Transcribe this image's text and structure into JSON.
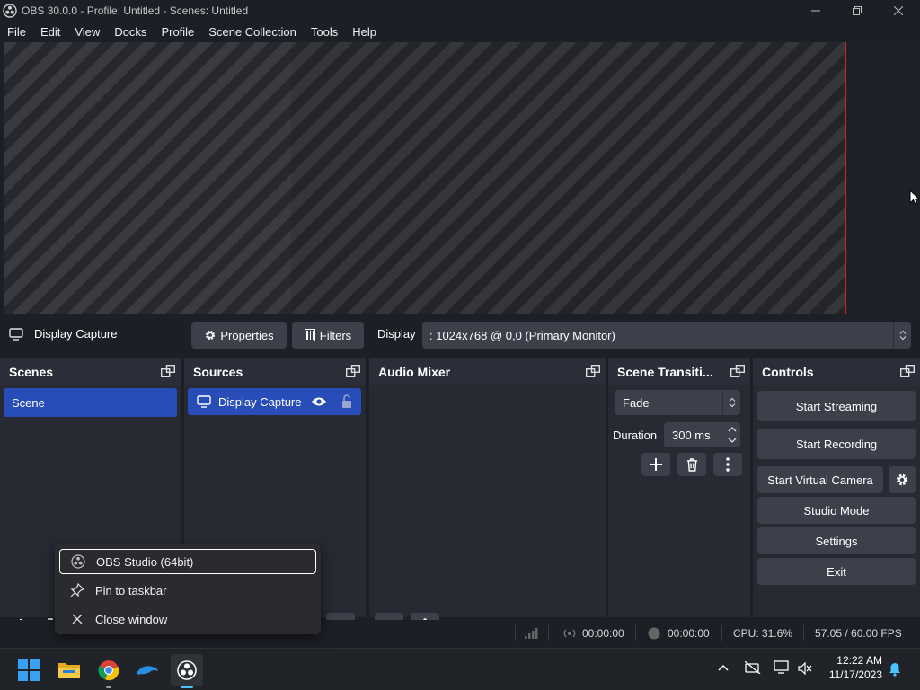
{
  "window": {
    "title": "OBS 30.0.0 - Profile: Untitled - Scenes: Untitled",
    "minimize_icon": "minimize-icon",
    "maximize_icon": "restore-icon",
    "close_icon": "close-icon"
  },
  "menu": [
    "File",
    "Edit",
    "View",
    "Docks",
    "Profile",
    "Scene Collection",
    "Tools",
    "Help"
  ],
  "source_toolbar": {
    "selected_source": "Display Capture",
    "properties_label": "Properties",
    "filters_label": "Filters",
    "display_label": "Display",
    "display_value": ": 1024x768 @ 0,0 (Primary Monitor)"
  },
  "docks": {
    "scenes": {
      "title": "Scenes",
      "items": [
        "Scene"
      ]
    },
    "sources": {
      "title": "Sources",
      "items": [
        "Display Capture"
      ]
    },
    "audio_mixer": {
      "title": "Audio Mixer"
    },
    "transitions": {
      "title": "Scene Transiti...",
      "selected": "Fade",
      "duration_label": "Duration",
      "duration_value": "300 ms"
    },
    "controls": {
      "title": "Controls",
      "start_streaming": "Start Streaming",
      "start_recording": "Start Recording",
      "start_virtual_camera": "Start Virtual Camera",
      "studio_mode": "Studio Mode",
      "settings": "Settings",
      "exit": "Exit"
    }
  },
  "status": {
    "stream_time": "00:00:00",
    "record_time": "00:00:00",
    "cpu": "CPU: 31.6%",
    "fps": "57.05 / 60.00 FPS"
  },
  "jump_list": {
    "app": "OBS Studio (64bit)",
    "pin": "Pin to taskbar",
    "close": "Close window"
  },
  "taskbar": {
    "time": "12:22 AM",
    "date": "11/17/2023"
  },
  "colors": {
    "accent": "#284cb8",
    "preview_border": "#d52020",
    "panel": "#272a33",
    "button": "#3c404b"
  }
}
